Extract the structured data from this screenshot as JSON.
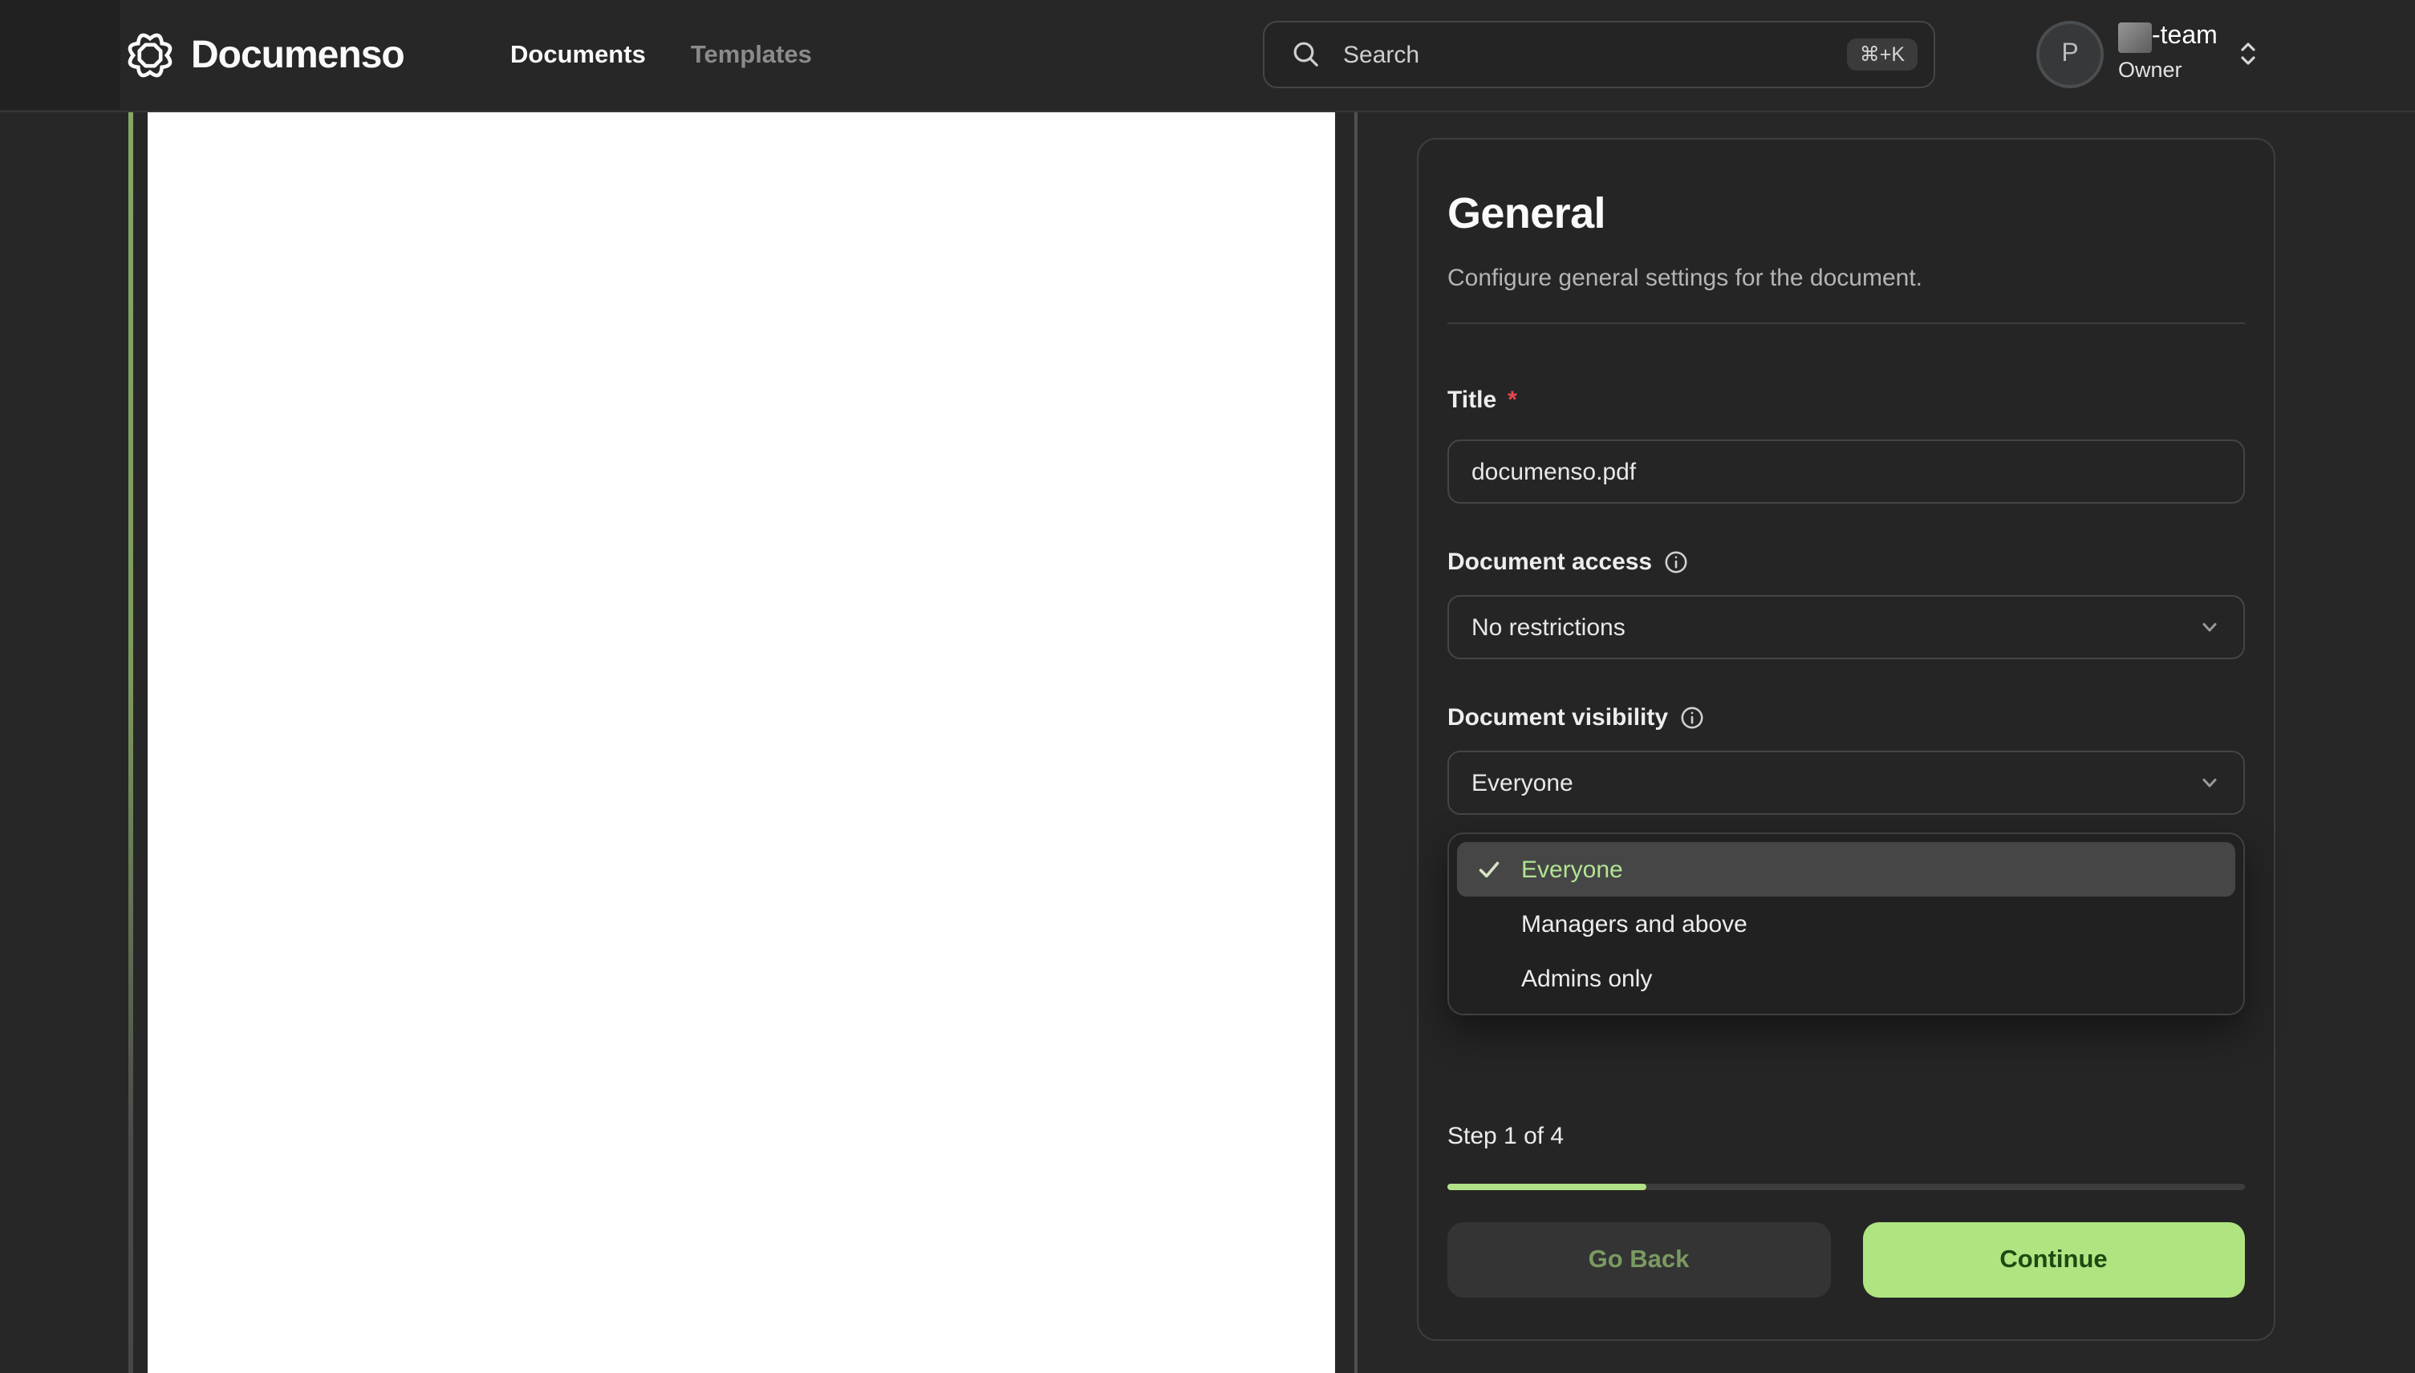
{
  "navbar": {
    "brand": "Documenso",
    "nav_items": [
      {
        "label": "Documents",
        "active": true
      },
      {
        "label": "Templates",
        "active": false
      }
    ],
    "search": {
      "placeholder": "Search",
      "shortcut": "⌘+K"
    },
    "user": {
      "avatar_initial": "P",
      "team_suffix": "-team",
      "role": "Owner"
    }
  },
  "panel": {
    "title": "General",
    "subtitle": "Configure general settings for the document.",
    "fields": {
      "title": {
        "label": "Title",
        "required_mark": "*",
        "value": "documenso.pdf"
      },
      "document_access": {
        "label": "Document access",
        "value": "No restrictions"
      },
      "document_visibility": {
        "label": "Document visibility",
        "value": "Everyone"
      }
    },
    "visibility_menu": {
      "options": [
        {
          "label": "Everyone",
          "selected": true
        },
        {
          "label": "Managers and above",
          "selected": false
        },
        {
          "label": "Admins only",
          "selected": false
        }
      ]
    },
    "footer": {
      "step_text": "Step 1 of 4",
      "progress_percent": 25,
      "go_back_label": "Go Back",
      "continue_label": "Continue"
    }
  },
  "colors": {
    "accent_green": "#afe481",
    "accent_green_text": "#1d4a12",
    "selected_option_green": "#b2e493",
    "progress_fill": "#b1e287",
    "required_red": "#e5484d"
  }
}
